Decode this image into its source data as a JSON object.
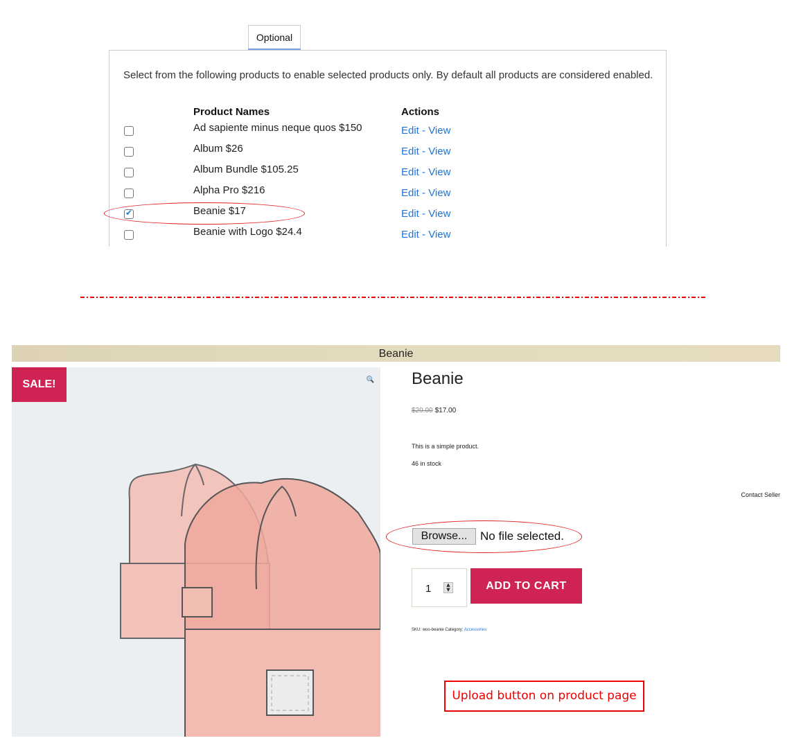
{
  "settings_panel": {
    "tabs": [
      {
        "label": "Optional",
        "active": true
      }
    ],
    "intro_text": "Select from the following products to enable selected products only. By default all products are considered enabled.",
    "columns": {
      "product_names": "Product Names",
      "actions": "Actions"
    },
    "products": [
      {
        "name": "Ad sapiente minus neque quos $150",
        "checked": false,
        "edit": "Edit",
        "sep": "-",
        "view": "View"
      },
      {
        "name": "Album $26",
        "checked": false,
        "edit": "Edit",
        "sep": "-",
        "view": "View"
      },
      {
        "name": "Album Bundle $105.25",
        "checked": false,
        "edit": "Edit",
        "sep": "-",
        "view": "View"
      },
      {
        "name": "Alpha Pro $216",
        "checked": false,
        "edit": "Edit",
        "sep": "-",
        "view": "View"
      },
      {
        "name": "Beanie $17",
        "checked": true,
        "edit": "Edit",
        "sep": "-",
        "view": "View"
      },
      {
        "name": "Beanie with Logo $24.4",
        "checked": false,
        "edit": "Edit",
        "sep": "-",
        "view": "View"
      }
    ]
  },
  "product_page": {
    "banner_title": "Beanie",
    "sale_badge": "SALE!",
    "zoom_icon": "magnifier-icon",
    "title": "Beanie",
    "price_old": "$20.00",
    "price_new": "$17.00",
    "description": "This is a simple product.",
    "stock": "46 in stock",
    "contact_seller": "Contact Seller",
    "file_upload": {
      "button_label": "Browse...",
      "status": "No file selected."
    },
    "quantity": "1",
    "add_to_cart": "ADD TO CART",
    "meta": {
      "sku_label": "SKU:",
      "sku": "woo-beanie",
      "category_label": "Category:",
      "category": "Accessories"
    }
  },
  "annotation": {
    "note": "Upload button on product page",
    "color": "#e00000"
  },
  "colors": {
    "brand": "#cf2453",
    "link": "#1f74d6",
    "tab_accent": "#7aa2ea"
  }
}
